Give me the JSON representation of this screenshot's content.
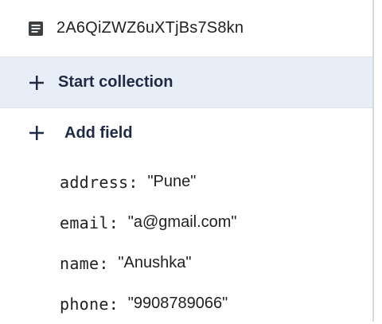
{
  "document": {
    "icon": "document-icon",
    "id": "2A6QiZWZ6uXTjBs7S8kn"
  },
  "actions": {
    "start_collection": {
      "icon": "plus-icon",
      "label": "Start collection"
    },
    "add_field": {
      "icon": "plus-icon",
      "label": "Add field"
    }
  },
  "fields": [
    {
      "key": "address",
      "colon": ":",
      "value": "\"Pune\""
    },
    {
      "key": "email",
      "colon": ":",
      "value": "\"a@gmail.com\""
    },
    {
      "key": "name",
      "colon": ":",
      "value": "\"Anushka\""
    },
    {
      "key": "phone",
      "colon": ":",
      "value": "\"9908789066\""
    }
  ],
  "colors": {
    "highlight_background": "#e8eef8",
    "text": "#202124",
    "action_text": "#1f2a44",
    "divider": "#e1e3e6"
  }
}
